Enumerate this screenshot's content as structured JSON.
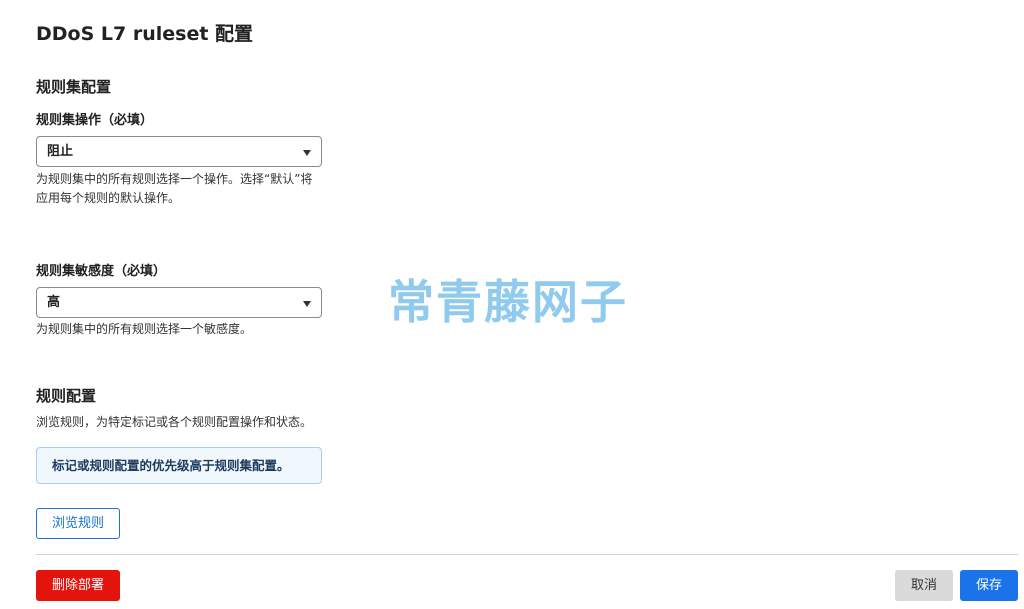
{
  "page": {
    "title": "DDoS L7 ruleset 配置"
  },
  "ruleset_config": {
    "heading": "规则集配置",
    "action": {
      "label": "规则集操作（必填）",
      "value": "阻止",
      "help": "为规则集中的所有规则选择一个操作。选择“默认”将应用每个规则的默认操作。"
    },
    "sensitivity": {
      "label": "规则集敏感度（必填）",
      "value": "高",
      "help": "为规则集中的所有规则选择一个敏感度。"
    }
  },
  "rule_config": {
    "heading": "规则配置",
    "description": "浏览规则，为特定标记或各个规则配置操作和状态。",
    "info": "标记或规则配置的优先级高于规则集配置。",
    "browse_button": "浏览规则"
  },
  "footer": {
    "delete_button": "删除部署",
    "cancel_button": "取消",
    "save_button": "保存"
  },
  "watermark": "常青藤网子",
  "colors": {
    "primary": "#1a73e8",
    "danger": "#e4130b",
    "info_bg": "#f0f7fd",
    "info_border": "#a9cdef"
  }
}
